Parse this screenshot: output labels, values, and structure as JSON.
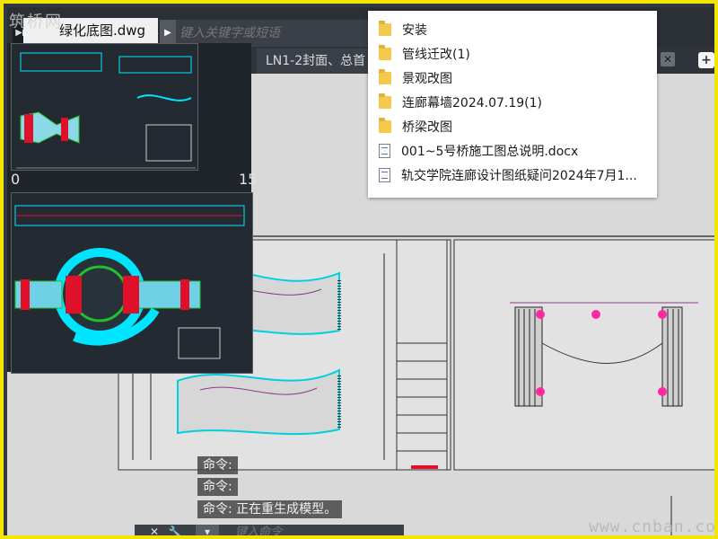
{
  "watermark_top": "筑桥网",
  "watermark_bottom": "www.cnban.com",
  "file_tab": {
    "label": "绿化底图.dwg"
  },
  "search": {
    "placeholder": "键入关键字或短语"
  },
  "doc_tab": {
    "label": "LN1-2封面、总首"
  },
  "preview_ruler": {
    "left": "0",
    "right": "15"
  },
  "folder_popup": {
    "items": [
      {
        "type": "folder",
        "label": "安装"
      },
      {
        "type": "folder",
        "label": "管线迁改(1)"
      },
      {
        "type": "folder",
        "label": "景观改图"
      },
      {
        "type": "folder",
        "label": "连廊幕墙2024.07.19(1)"
      },
      {
        "type": "folder",
        "label": "桥梁改图"
      },
      {
        "type": "doc",
        "label": "001~5号桥施工图总说明.docx"
      },
      {
        "type": "doc",
        "label": "轨交学院连廊设计图纸疑问2024年7月1..."
      }
    ]
  },
  "command_history": [
    "命令:",
    "命令:",
    "命令: 正在重生成模型。"
  ],
  "command_bar": {
    "close_label": "✕",
    "wrench_label": "🔧",
    "dropdown_label": "▾",
    "placeholder": "键入命令"
  },
  "colors": {
    "highlight_border": "#f2e600",
    "canvas": "#d9d9d9",
    "folder": "#f2c94c",
    "cyan": "#00e5ff",
    "red": "#e0102a",
    "green": "#22c02a"
  }
}
